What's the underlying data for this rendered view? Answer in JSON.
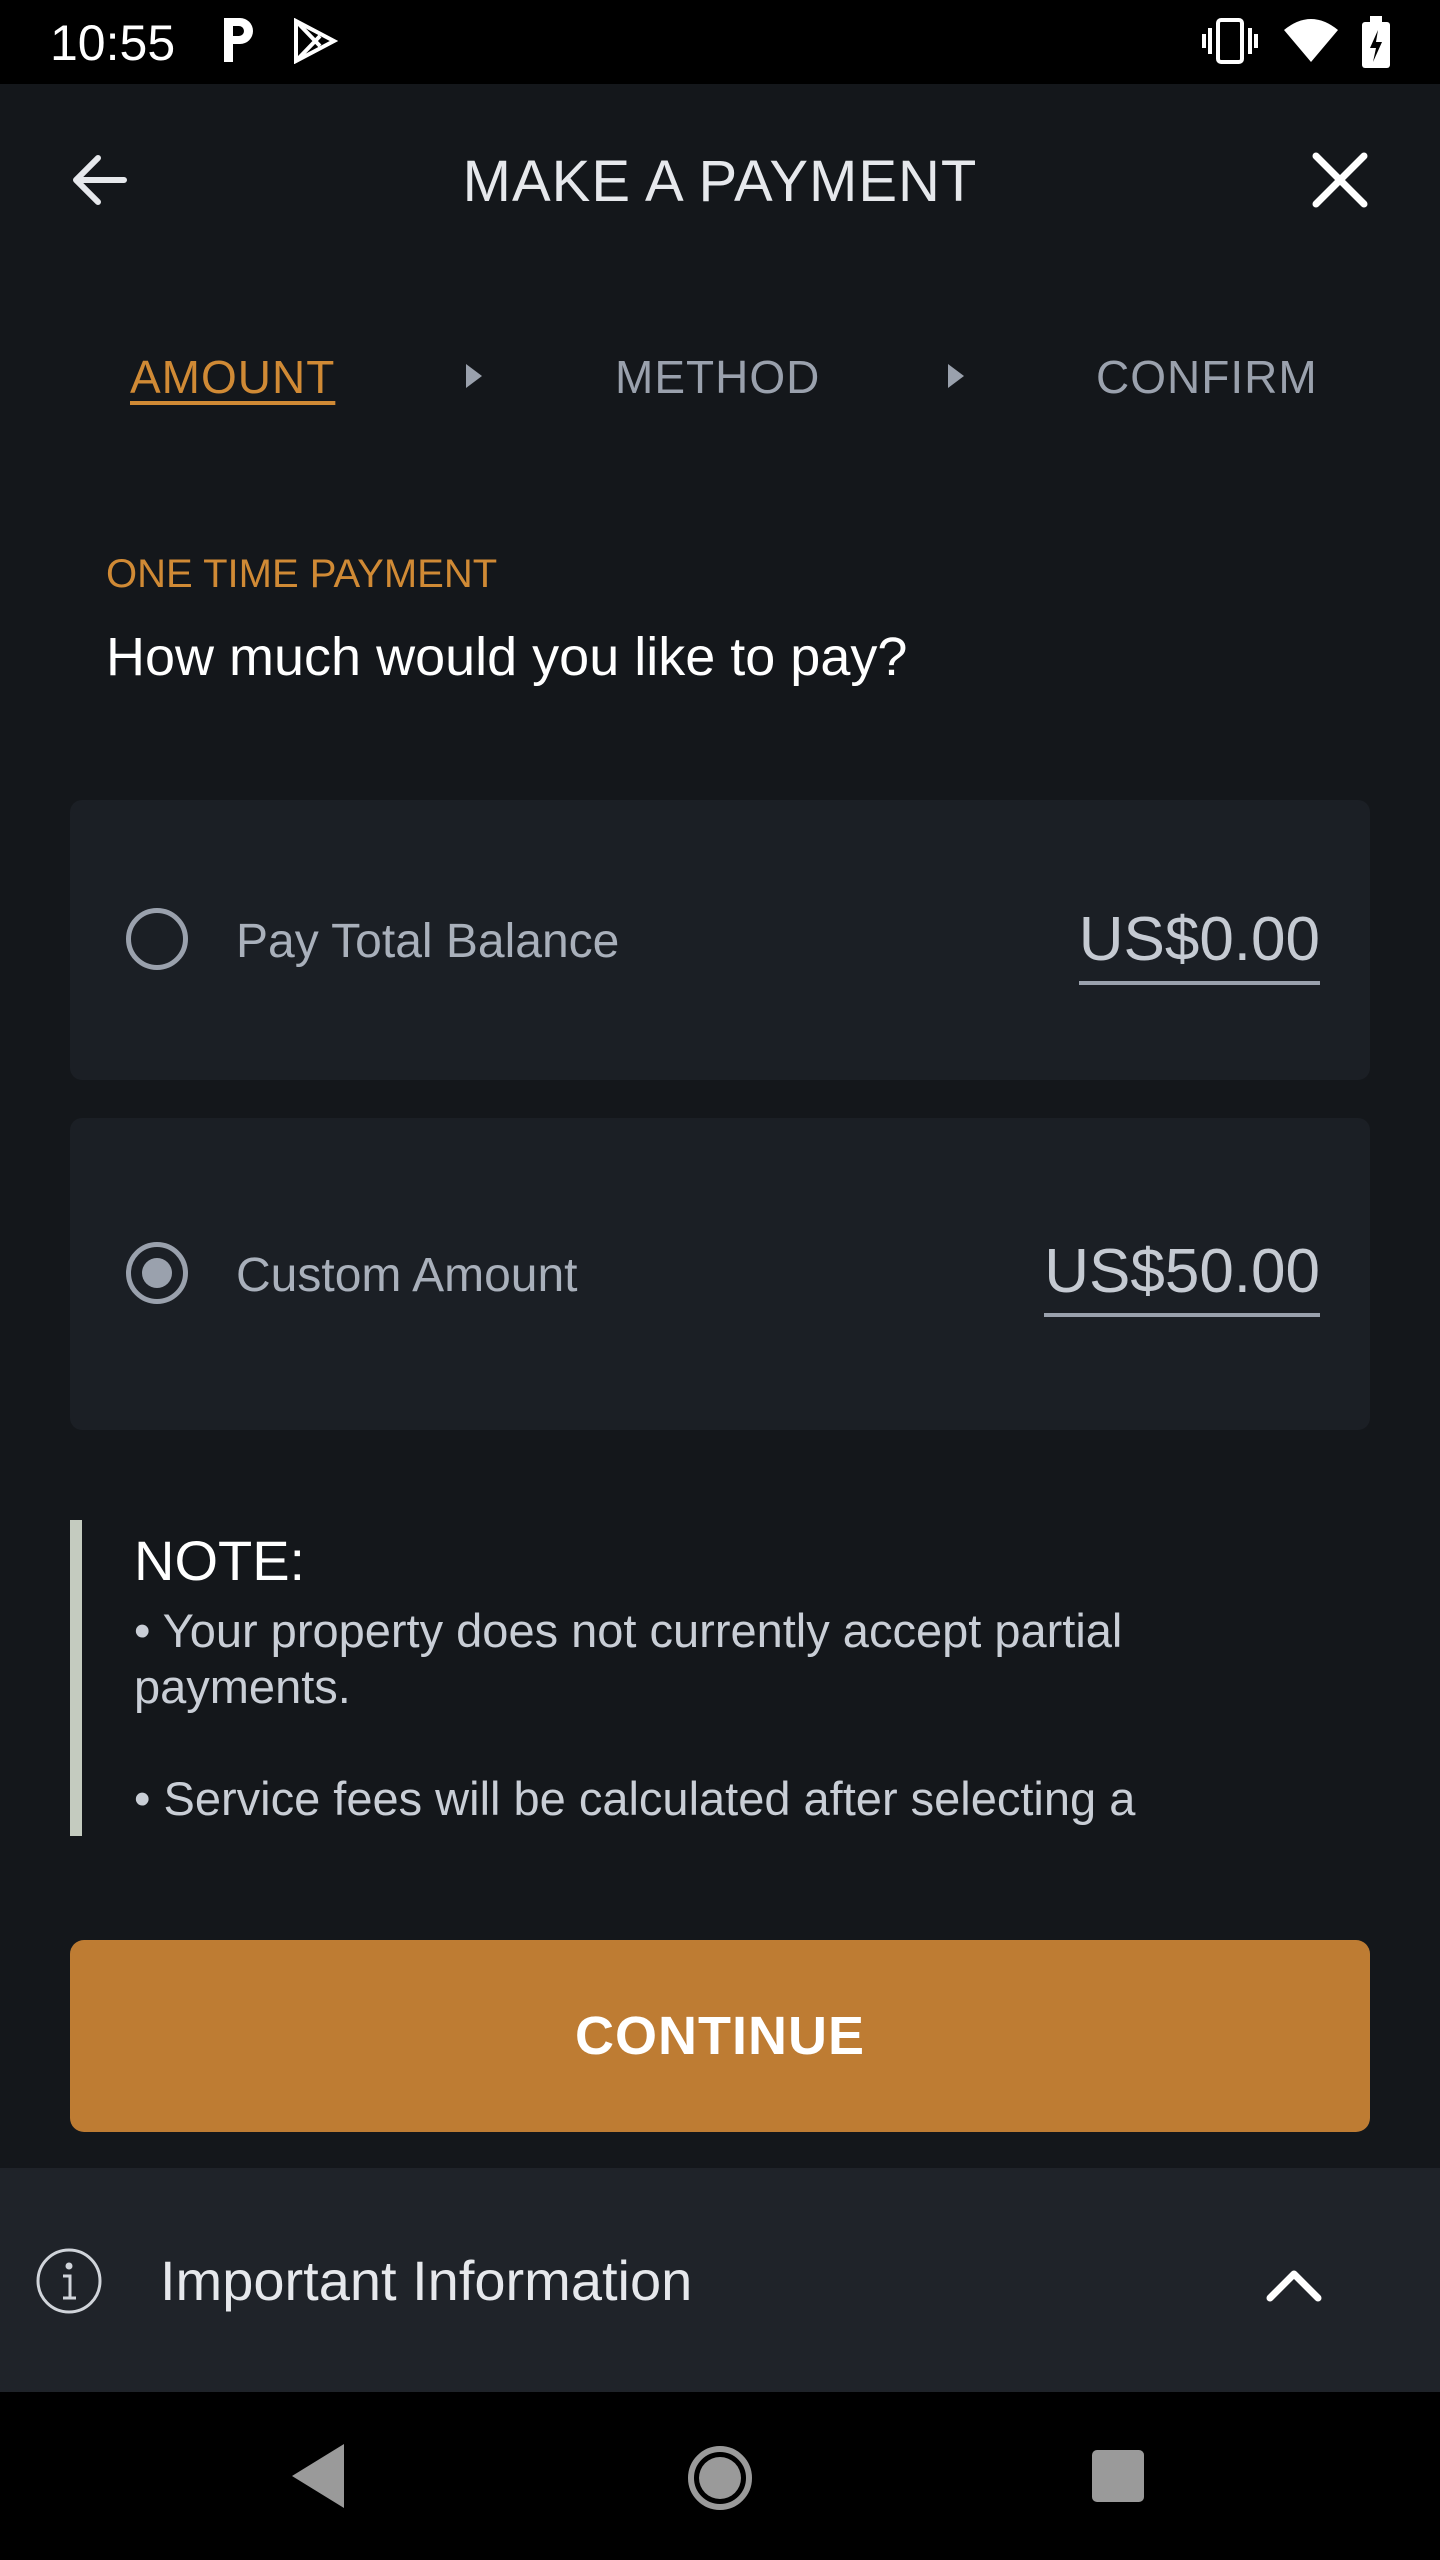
{
  "status_bar": {
    "time": "10:55",
    "icons": [
      "parking-p-icon",
      "play-store-icon",
      "vibrate-icon",
      "wifi-icon",
      "battery-charging-icon"
    ]
  },
  "header": {
    "title": "MAKE A PAYMENT",
    "back_icon": "arrow-left-icon",
    "close_icon": "close-icon"
  },
  "steps": [
    {
      "label": "AMOUNT",
      "active": true
    },
    {
      "label": "METHOD",
      "active": false
    },
    {
      "label": "CONFIRM",
      "active": false
    }
  ],
  "payment": {
    "type_label": "ONE TIME PAYMENT",
    "question": "How much would you like to pay?",
    "options": [
      {
        "label": "Pay Total Balance",
        "amount": "US$0.00",
        "selected": false
      },
      {
        "label": "Custom Amount",
        "amount": "US$50.00",
        "selected": true
      }
    ]
  },
  "note": {
    "title": "NOTE:",
    "lines": [
      "• Your property does not currently accept partial payments.",
      "• Service fees will be calculated after selecting a"
    ]
  },
  "continue_label": "CONTINUE",
  "important_info": {
    "label": "Important Information",
    "icon": "info-icon",
    "toggle_icon": "chevron-up-icon"
  },
  "colors": {
    "background": "#14171b",
    "accent": "#be7c33",
    "active_step": "#d08a35",
    "card": "#1b1f25"
  }
}
